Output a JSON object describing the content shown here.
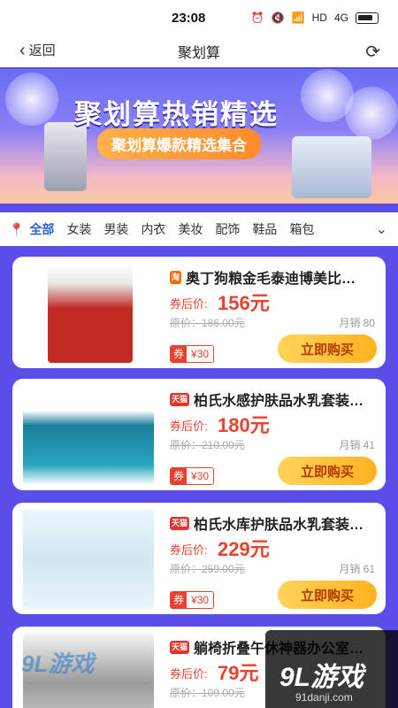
{
  "status": {
    "time": "23:08",
    "network": "4G",
    "wifi": "HD"
  },
  "nav": {
    "back_label": "返回",
    "title": "聚划算"
  },
  "banner": {
    "title": "聚划算热销精选",
    "subtitle": "聚划算爆款精选集合"
  },
  "categories": [
    "全部",
    "女装",
    "男装",
    "内衣",
    "美妆",
    "配饰",
    "鞋品",
    "箱包"
  ],
  "products": [
    {
      "shop": "淘",
      "title": "奥丁狗粮金毛泰迪博美比…",
      "price_label": "券后价:",
      "price": "156元",
      "original": "原价：186.00元",
      "sales": "月销 80",
      "coupon_tag": "券",
      "coupon_value": "¥30",
      "buy_label": "立即购买"
    },
    {
      "shop": "天猫",
      "title": "柏氏水感护肤品水乳套装…",
      "price_label": "券后价:",
      "price": "180元",
      "original": "原价：210.00元",
      "sales": "月销 41",
      "coupon_tag": "券",
      "coupon_value": "¥30",
      "buy_label": "立即购买"
    },
    {
      "shop": "天猫",
      "title": "柏氏水库护肤品水乳套装…",
      "price_label": "券后价:",
      "price": "229元",
      "original": "原价：259.00元",
      "sales": "月销 61",
      "coupon_tag": "券",
      "coupon_value": "¥30",
      "buy_label": "立即购买"
    },
    {
      "shop": "天猫",
      "title": "躺椅折叠午休神器办公室…",
      "price_label": "券后价:",
      "price": "79元",
      "original": "原价：109.00元"
    }
  ],
  "watermark": {
    "left": "9L游戏",
    "brand": "9L游戏",
    "site": "91danji.com"
  }
}
